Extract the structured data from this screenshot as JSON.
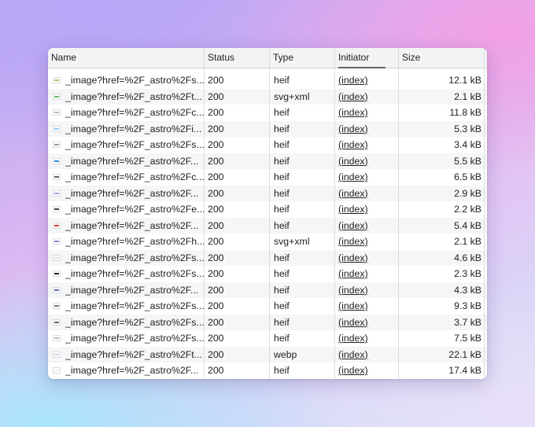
{
  "columns": {
    "name": "Name",
    "status": "Status",
    "type": "Type",
    "initiator": "Initiator",
    "size": "Size"
  },
  "rows": [
    {
      "name": "_image?href=%2F_astro%2Fs...",
      "status": "200",
      "type": "heif",
      "initiator": "(index)",
      "size": "12.1 kB",
      "thumb_color": "#9ccc65"
    },
    {
      "name": "_image?href=%2F_astro%2Ft...",
      "status": "200",
      "type": "svg+xml",
      "initiator": "(index)",
      "size": "2.1 kB",
      "thumb_color": "#66bb6a"
    },
    {
      "name": "_image?href=%2F_astro%2Fc...",
      "status": "200",
      "type": "heif",
      "initiator": "(index)",
      "size": "11.8 kB",
      "thumb_color": "#b0bec5"
    },
    {
      "name": "_image?href=%2F_astro%2Fi...",
      "status": "200",
      "type": "heif",
      "initiator": "(index)",
      "size": "5.3 kB",
      "thumb_color": "#90caf9"
    },
    {
      "name": "_image?href=%2F_astro%2Fs...",
      "status": "200",
      "type": "heif",
      "initiator": "(index)",
      "size": "3.4 kB",
      "thumb_color": "#9e9e9e"
    },
    {
      "name": "_image?href=%2F_astro%2F...",
      "status": "200",
      "type": "heif",
      "initiator": "(index)",
      "size": "5.5 kB",
      "thumb_color": "#1e88e5"
    },
    {
      "name": "_image?href=%2F_astro%2Fc...",
      "status": "200",
      "type": "heif",
      "initiator": "(index)",
      "size": "6.5 kB",
      "thumb_color": "#616161"
    },
    {
      "name": "_image?href=%2F_astro%2F...",
      "status": "200",
      "type": "heif",
      "initiator": "(index)",
      "size": "2.9 kB",
      "thumb_color": "#b39ddb"
    },
    {
      "name": "_image?href=%2F_astro%2Fe...",
      "status": "200",
      "type": "heif",
      "initiator": "(index)",
      "size": "2.2 kB",
      "thumb_color": "#424242"
    },
    {
      "name": "_image?href=%2F_astro%2F...",
      "status": "200",
      "type": "heif",
      "initiator": "(index)",
      "size": "5.4 kB",
      "thumb_color": "#e53935"
    },
    {
      "name": "_image?href=%2F_astro%2Fh...",
      "status": "200",
      "type": "svg+xml",
      "initiator": "(index)",
      "size": "2.1 kB",
      "thumb_color": "#7986cb"
    },
    {
      "name": "_image?href=%2F_astro%2Fs...",
      "status": "200",
      "type": "heif",
      "initiator": "(index)",
      "size": "4.6 kB",
      "thumb_color": "#e0e0e0"
    },
    {
      "name": "_image?href=%2F_astro%2Fs...",
      "status": "200",
      "type": "heif",
      "initiator": "(index)",
      "size": "2.3 kB",
      "thumb_color": "#212121"
    },
    {
      "name": "_image?href=%2F_astro%2F...",
      "status": "200",
      "type": "heif",
      "initiator": "(index)",
      "size": "4.3 kB",
      "thumb_color": "#5c6bc0"
    },
    {
      "name": "_image?href=%2F_astro%2Fs...",
      "status": "200",
      "type": "heif",
      "initiator": "(index)",
      "size": "9.3 kB",
      "thumb_color": "#757575"
    },
    {
      "name": "_image?href=%2F_astro%2Fs...",
      "status": "200",
      "type": "heif",
      "initiator": "(index)",
      "size": "3.7 kB",
      "thumb_color": "#616161"
    },
    {
      "name": "_image?href=%2F_astro%2Fs...",
      "status": "200",
      "type": "heif",
      "initiator": "(index)",
      "size": "7.5 kB",
      "thumb_color": "#bdbdbd"
    },
    {
      "name": "_image?href=%2F_astro%2Ft...",
      "status": "200",
      "type": "webp",
      "initiator": "(index)",
      "size": "22.1 kB",
      "thumb_color": "#cfd8dc"
    },
    {
      "name": "_image?href=%2F_astro%2F...",
      "status": "200",
      "type": "heif",
      "initiator": "(index)",
      "size": "17.4 kB",
      "thumb_color": "#eceff1"
    }
  ]
}
